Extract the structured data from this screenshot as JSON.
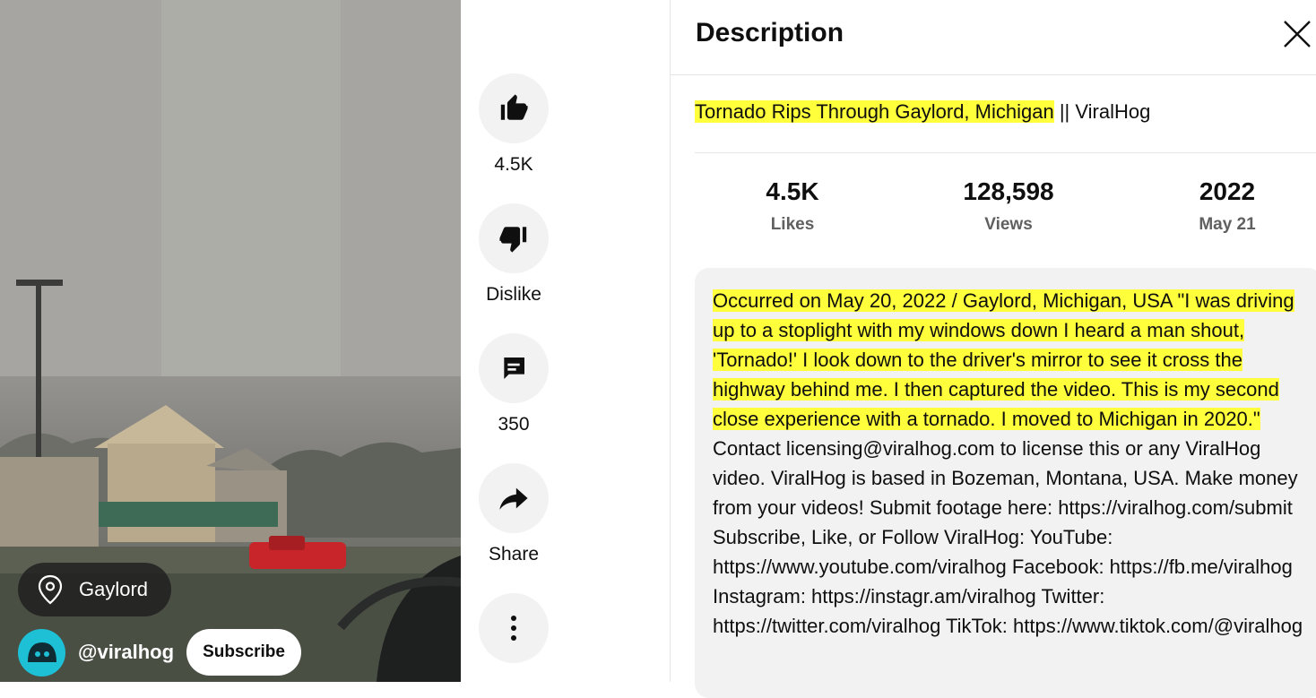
{
  "video": {
    "location_label": "Gaylord",
    "channel_handle": "@viralhog",
    "subscribe_label": "Subscribe"
  },
  "actions": {
    "like_count": "4.5K",
    "dislike_label": "Dislike",
    "comment_count": "350",
    "share_label": "Share"
  },
  "icons": {
    "like": "thumb-up-icon",
    "dislike": "thumb-down-icon",
    "comment": "comment-icon",
    "share": "share-icon",
    "more": "more-vertical-icon",
    "location": "location-pin-icon",
    "close": "close-icon"
  },
  "panel": {
    "title": "Description",
    "video_title_highlighted": "Tornado Rips Through Gaylord, Michigan",
    "video_title_rest": " || ViralHog",
    "stats": [
      {
        "value": "4.5K",
        "label": "Likes"
      },
      {
        "value": "128,598",
        "label": "Views"
      },
      {
        "value": "2022",
        "label": "May 21"
      }
    ],
    "description_highlighted": "Occurred on May 20, 2022 / Gaylord, Michigan, USA \"I was driving up to a stoplight with my windows down I heard a man shout, 'Tornado!' I look down to the driver's mirror to see it cross the highway behind me. I then captured the video. This is my second close experience with a tornado. I moved to Michigan in 2020.\"",
    "description_rest": " Contact licensing@viralhog.com to license this or any ViralHog video. ViralHog is based in Bozeman, Montana, USA. Make money from your videos! Submit footage here: https://viralhog.com/submit Subscribe, Like, or Follow ViralHog: YouTube: https://www.youtube.com/viralhog Facebook: https://fb.me/viralhog Instagram: https://instagr.am/viralhog Twitter: https://twitter.com/viralhog TikTok: https://www.tiktok.com/@viralhog"
  },
  "colors": {
    "highlight": "#ffff3b",
    "avatar": "#1ec0d6",
    "button_bg": "#f2f2f2"
  }
}
